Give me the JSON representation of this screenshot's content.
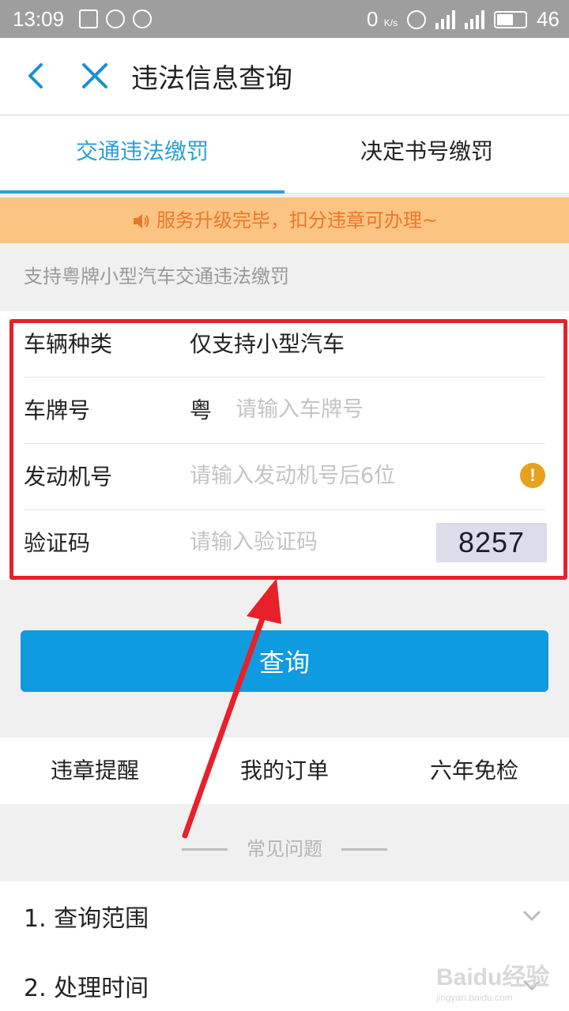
{
  "status_bar": {
    "time": "13:09",
    "net_speed": "0",
    "net_unit": "K/s",
    "battery_level": "46"
  },
  "nav": {
    "title": "违法信息查询"
  },
  "tabs": [
    {
      "label": "交通违法缴罚",
      "active": true
    },
    {
      "label": "决定书号缴罚",
      "active": false
    }
  ],
  "notice": "服务升级完毕，扣分违章可办理~",
  "subtip": "支持粤牌小型汽车交通违法缴罚",
  "form": {
    "vehicle_type": {
      "label": "车辆种类",
      "value": "仅支持小型汽车"
    },
    "plate": {
      "label": "车牌号",
      "prefix": "粤",
      "placeholder": "请输入车牌号"
    },
    "engine": {
      "label": "发动机号",
      "placeholder": "请输入发动机号后6位"
    },
    "captcha": {
      "label": "验证码",
      "placeholder": "请输入验证码",
      "code": "8257"
    }
  },
  "query_button": "查询",
  "links": [
    "违章提醒",
    "我的订单",
    "六年免检"
  ],
  "faq": {
    "title": "常见问题",
    "items": [
      "1. 查询范围",
      "2. 处理时间"
    ]
  },
  "watermark": {
    "brand": "Baidu经验",
    "url": "jingyan.baidu.com"
  },
  "colors": {
    "accent": "#2a9fd6",
    "button": "#0f9be0",
    "notice_bg": "#fcc483",
    "notice_text": "#e8792a",
    "highlight": "#e8202a"
  }
}
